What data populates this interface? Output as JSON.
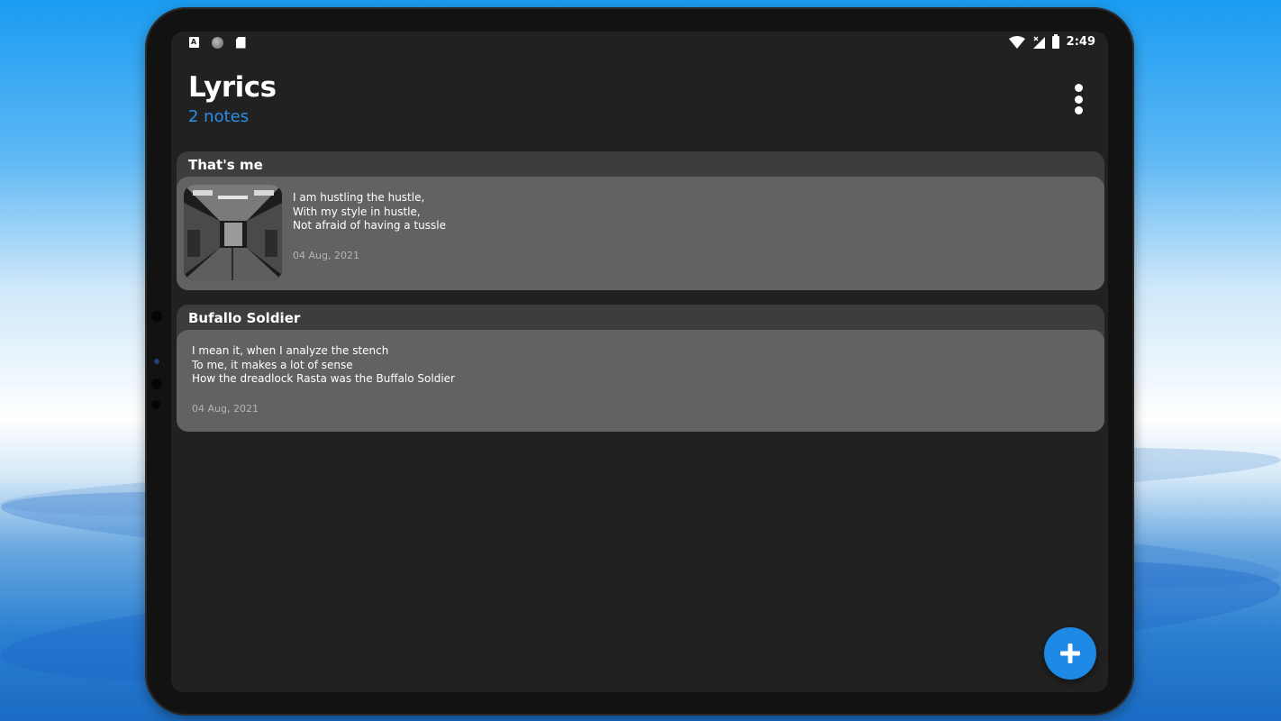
{
  "status_bar": {
    "left_icons": [
      "a-notification-icon",
      "circle-notification-icon",
      "sd-card-icon"
    ],
    "right_icons": [
      "wifi-icon",
      "signal-icon",
      "battery-icon"
    ],
    "time": "2:49"
  },
  "header": {
    "title": "Lyrics",
    "subtitle": "2 notes",
    "menu_icon": "more-vert-icon"
  },
  "notes": [
    {
      "title": "That's me",
      "body": "I am hustling the hustle,\nWith my style in hustle,\nNot afraid of having a tussle",
      "date": "04 Aug, 2021",
      "has_image": true
    },
    {
      "title": "Bufallo Soldier",
      "body": "I mean it, when I analyze the stench\nTo me, it makes a lot of sense\nHow the dreadlock Rasta was the Buffalo Soldier",
      "date": "04 Aug, 2021",
      "has_image": false
    }
  ],
  "fab": {
    "icon": "plus-icon"
  },
  "colors": {
    "screen_bg": "#212121",
    "card_header": "#3d3d3d",
    "card_body": "#626262",
    "accent": "#1e88e5",
    "subtitle": "#2b8ee8"
  }
}
